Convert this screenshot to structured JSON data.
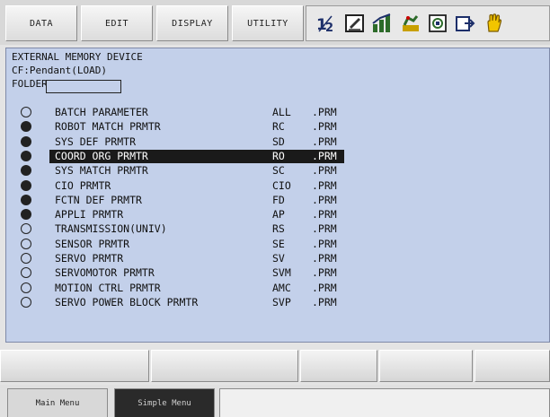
{
  "menu": [
    "DATA",
    "EDIT",
    "DISPLAY",
    "UTILITY"
  ],
  "toolbar_icons": [
    "numeric-switch-icon",
    "edit-box-icon",
    "graph-icon",
    "robot-icon",
    "panel-icon",
    "export-icon",
    "hand-icon"
  ],
  "header": {
    "line1": "EXTERNAL MEMORY DEVICE",
    "line2": "CF:Pendant(LOAD)",
    "folder_label": "FOLDER",
    "folder_value": ""
  },
  "files": [
    {
      "name": "BATCH PARAMETER",
      "code": "ALL",
      "ext": ".PRM",
      "marked": false
    },
    {
      "name": "ROBOT MATCH PRMTR",
      "code": "RC",
      "ext": ".PRM",
      "marked": true
    },
    {
      "name": "SYS DEF PRMTR",
      "code": "SD",
      "ext": ".PRM",
      "marked": true
    },
    {
      "name": "COORD ORG PRMTR",
      "code": "RO",
      "ext": ".PRM",
      "marked": true,
      "selected": true
    },
    {
      "name": "SYS MATCH PRMTR",
      "code": "SC",
      "ext": ".PRM",
      "marked": true
    },
    {
      "name": "CIO PRMTR",
      "code": "CIO",
      "ext": ".PRM",
      "marked": true
    },
    {
      "name": "FCTN DEF PRMTR",
      "code": "FD",
      "ext": ".PRM",
      "marked": true
    },
    {
      "name": "APPLI PRMTR",
      "code": "AP",
      "ext": ".PRM",
      "marked": true
    },
    {
      "name": "TRANSMISSION(UNIV)",
      "code": "RS",
      "ext": ".PRM",
      "marked": false
    },
    {
      "name": "SENSOR PRMTR",
      "code": "SE",
      "ext": ".PRM",
      "marked": false
    },
    {
      "name": "SERVO PRMTR",
      "code": "SV",
      "ext": ".PRM",
      "marked": false
    },
    {
      "name": "SERVOMOTOR PRMTR",
      "code": "SVM",
      "ext": ".PRM",
      "marked": false
    },
    {
      "name": "MOTION CTRL PRMTR",
      "code": "AMC",
      "ext": ".PRM",
      "marked": false
    },
    {
      "name": "SERVO POWER BLOCK PRMTR",
      "code": "SVP",
      "ext": ".PRM",
      "marked": false
    }
  ],
  "function_keys": [
    "",
    "",
    "",
    "",
    ""
  ],
  "bottom": {
    "main_menu": "Main Menu",
    "simple_menu": "Simple Menu"
  },
  "colors": {
    "screen_bg": "#c3d0ea",
    "selected_bg": "#1a1a1a"
  }
}
